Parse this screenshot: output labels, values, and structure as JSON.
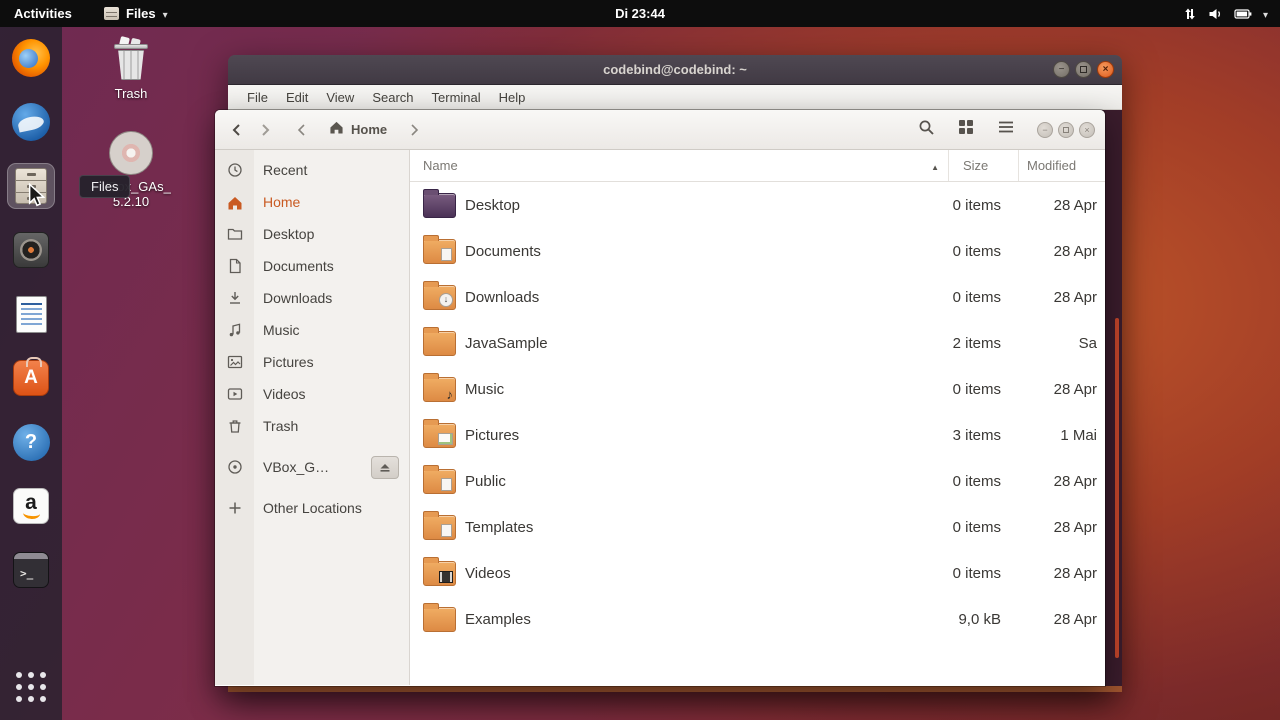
{
  "topbar": {
    "activities_label": "Activities",
    "app_menu_label": "Files",
    "clock": "Di 23:44",
    "tray_icons": [
      "network-icon",
      "volume-icon",
      "battery-icon",
      "chevron-down-icon"
    ]
  },
  "dock": {
    "tooltip": "Files",
    "items": [
      {
        "name": "firefox"
      },
      {
        "name": "thunderbird"
      },
      {
        "name": "files"
      },
      {
        "name": "rhythmbox"
      },
      {
        "name": "libreoffice-writer"
      },
      {
        "name": "ubuntu-software"
      },
      {
        "name": "help"
      },
      {
        "name": "amazon"
      },
      {
        "name": "terminal"
      }
    ],
    "show_apps": "show-applications"
  },
  "desktop": {
    "icons": [
      {
        "label": "Trash"
      },
      {
        "label_line1": "VBox_GAs_",
        "label_line2": "5.2.10"
      }
    ]
  },
  "terminal": {
    "title": "codebind@codebind: ~",
    "menu": [
      {
        "label": "File"
      },
      {
        "label": "Edit"
      },
      {
        "label": "View"
      },
      {
        "label": "Search"
      },
      {
        "label": "Terminal"
      },
      {
        "label": "Help"
      }
    ]
  },
  "files": {
    "tab_label": "Home",
    "columns": {
      "name": "Name",
      "size": "Size",
      "modified": "Modified"
    },
    "sidebar": [
      {
        "label": "Recent"
      },
      {
        "label": "Home",
        "active": true
      },
      {
        "label": "Desktop"
      },
      {
        "label": "Documents"
      },
      {
        "label": "Downloads"
      },
      {
        "label": "Music"
      },
      {
        "label": "Pictures"
      },
      {
        "label": "Videos"
      },
      {
        "label": "Trash"
      },
      {
        "label": "VBox_G…"
      },
      {
        "label": "Other Locations"
      }
    ],
    "rows": [
      {
        "name": "Desktop",
        "size": "0 items",
        "modified": "28 Apr"
      },
      {
        "name": "Documents",
        "size": "0 items",
        "modified": "28 Apr"
      },
      {
        "name": "Downloads",
        "size": "0 items",
        "modified": "28 Apr"
      },
      {
        "name": "JavaSample",
        "size": "2 items",
        "modified": "Sa"
      },
      {
        "name": "Music",
        "size": "0 items",
        "modified": "28 Apr"
      },
      {
        "name": "Pictures",
        "size": "3 items",
        "modified": "1 Mai"
      },
      {
        "name": "Public",
        "size": "0 items",
        "modified": "28 Apr"
      },
      {
        "name": "Templates",
        "size": "0 items",
        "modified": "28 Apr"
      },
      {
        "name": "Videos",
        "size": "0 items",
        "modified": "28 Apr"
      },
      {
        "name": "Examples",
        "size": "9,0 kB",
        "modified": "28 Apr"
      }
    ]
  }
}
